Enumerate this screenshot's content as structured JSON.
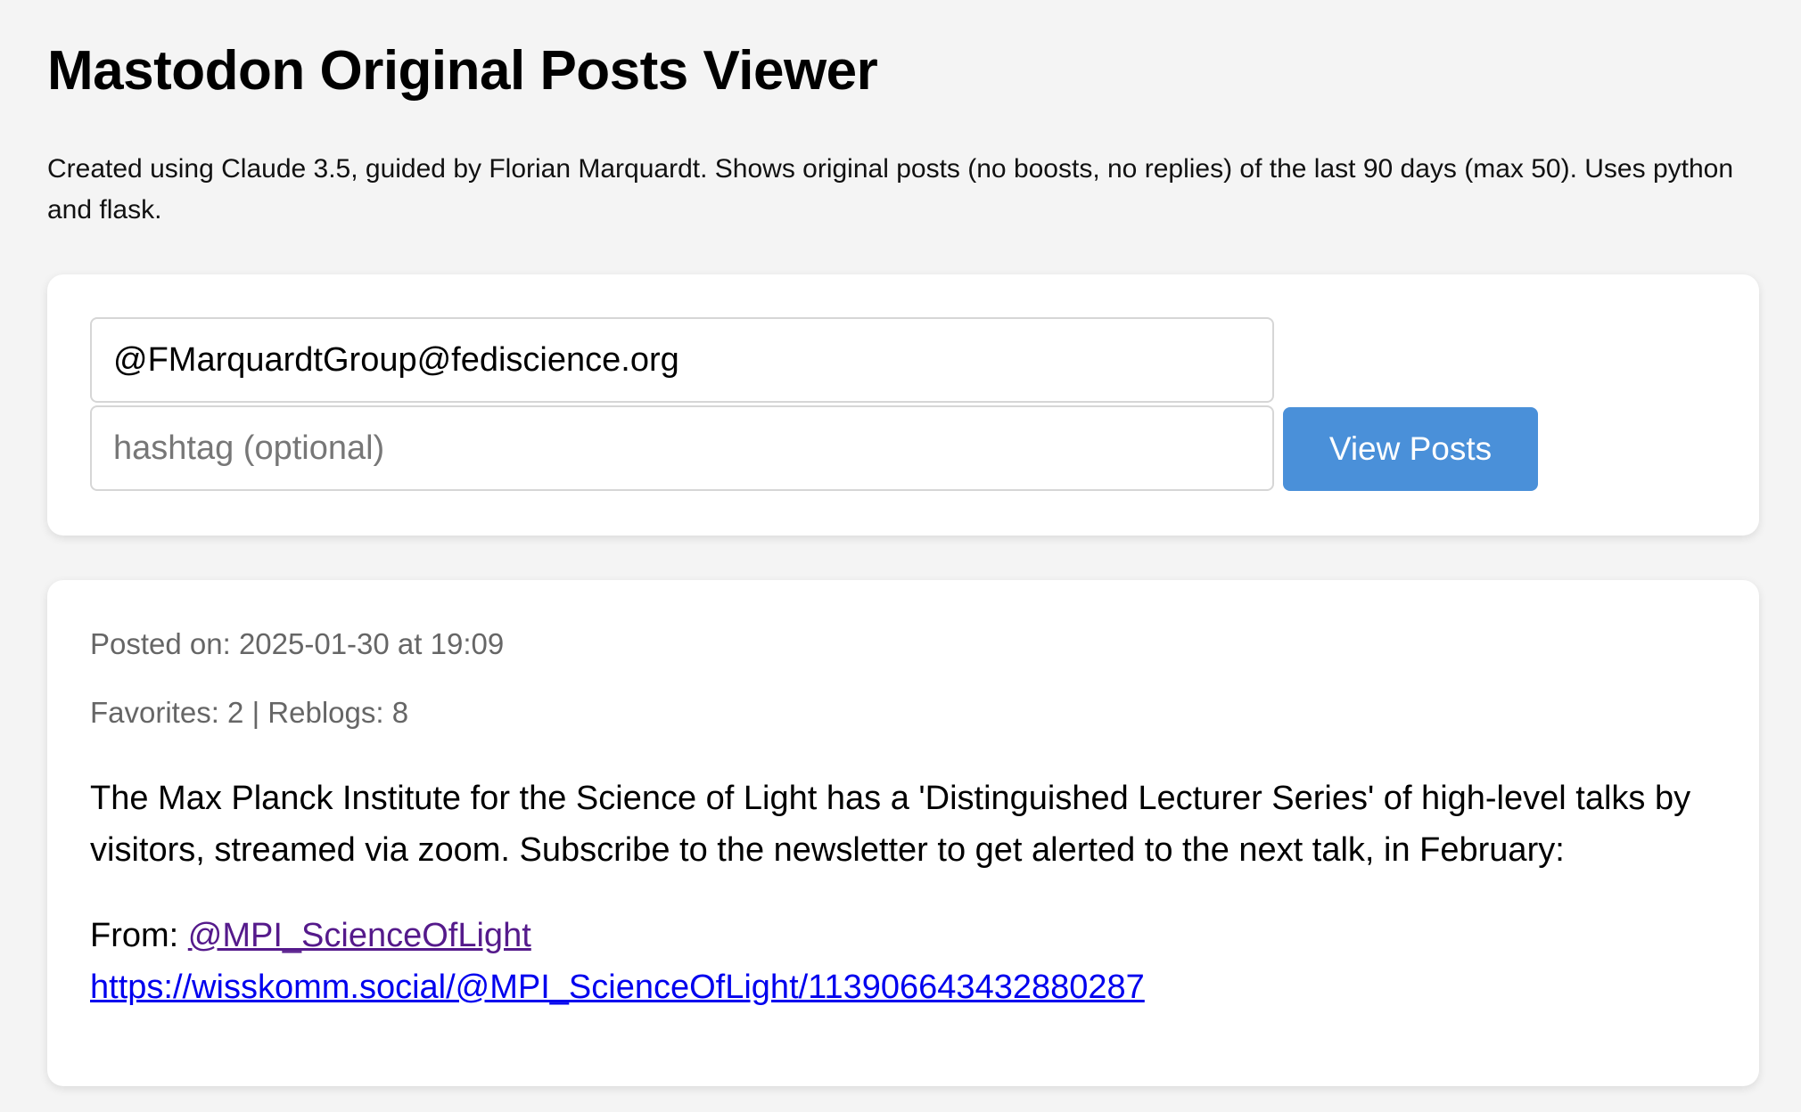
{
  "page": {
    "title": "Mastodon Original Posts Viewer",
    "description": "Created using Claude 3.5, guided by Florian Marquardt. Shows original posts (no boosts, no replies) of the last 90 days (max 50). Uses python and flask."
  },
  "search": {
    "account_value": "@FMarquardtGroup@fediscience.org",
    "hashtag_placeholder": "hashtag (optional)",
    "hashtag_value": "",
    "submit_label": "View Posts"
  },
  "posts": [
    {
      "posted_on": "Posted on: 2025-01-30 at 19:09",
      "stats": "Favorites: 2 | Reblogs: 8",
      "content": "The Max Planck Institute for the Science of Light has a 'Distinguished Lecturer Series' of high-level talks by visitors, streamed via zoom. Subscribe to the newsletter to get alerted to the next talk, in February:",
      "from_label": "From: ",
      "from_handle": "@MPI_ScienceOfLight",
      "link": "https://wisskomm.social/@MPI_ScienceOfLight/113906643432880287"
    }
  ],
  "colors": {
    "background": "#f4f4f4",
    "button": "#4a90d9",
    "visited_link": "#551a8b",
    "link": "#0000ee"
  }
}
